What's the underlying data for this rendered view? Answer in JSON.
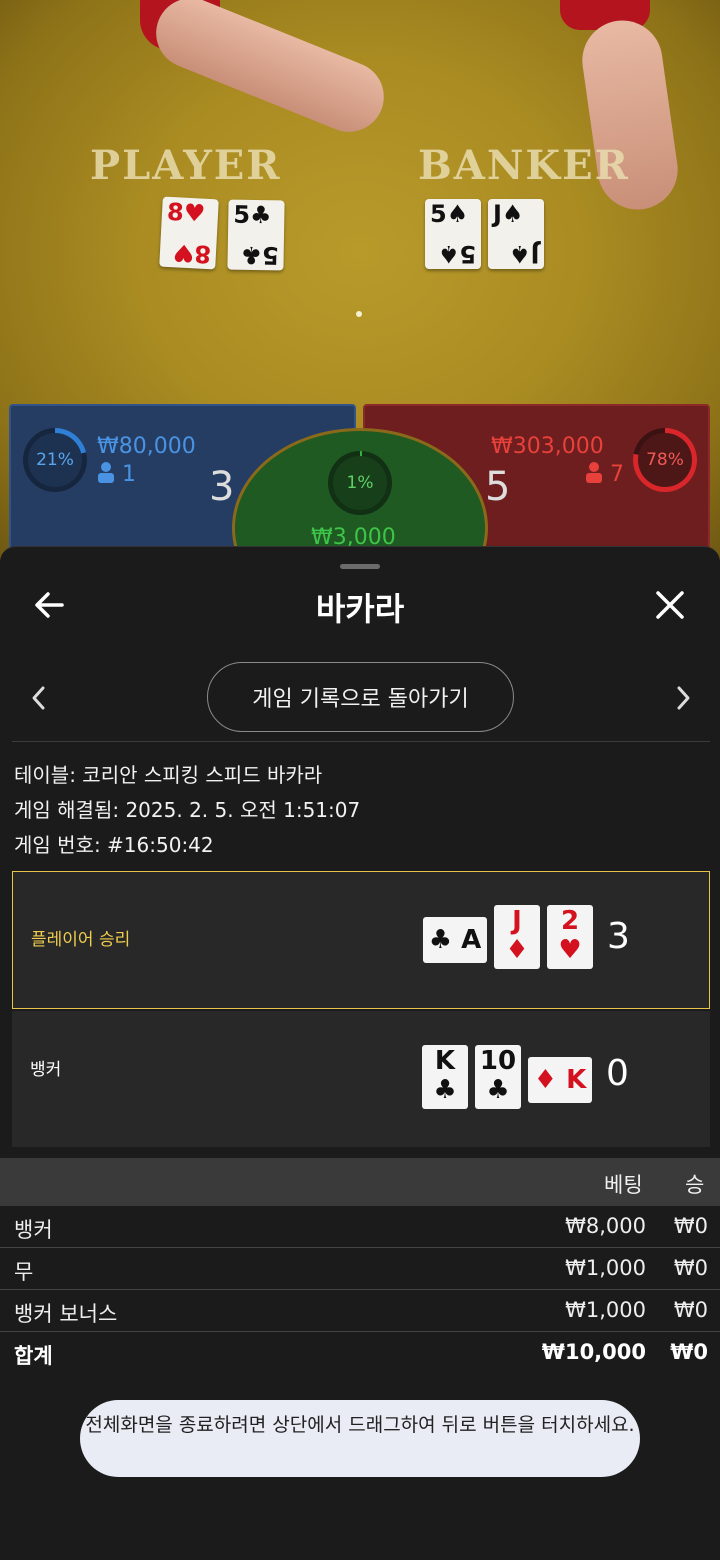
{
  "video": {
    "table_player": "PLAYER",
    "table_banker": "BANKER",
    "player_cards": [
      {
        "rank": "8",
        "suit": "♥",
        "red": true
      },
      {
        "rank": "5",
        "suit": "♣",
        "red": false
      }
    ],
    "banker_cards": [
      {
        "rank": "5",
        "suit": "♠",
        "red": false
      },
      {
        "rank": "J",
        "suit": "♠",
        "red": false
      }
    ],
    "player_panel": {
      "percent": "21%",
      "percent_value": 0.21,
      "amount": "₩80,000",
      "players": "1",
      "score": "3"
    },
    "banker_panel": {
      "percent": "78%",
      "percent_value": 0.78,
      "amount": "₩303,000",
      "players": "7",
      "score": "5"
    },
    "tie_panel": {
      "percent": "1%",
      "percent_value": 0.01,
      "amount": "₩3,000"
    }
  },
  "sheet": {
    "title": "바카라",
    "history_button": "게임 기록으로 돌아가기",
    "table_info": "테이블: 코리안 스피킹 스피드 바카라",
    "resolved_info": "게임 해결됨: 2025. 2. 5. 오전 1:51:07",
    "game_number": "게임 번호: #16:50:42",
    "results": {
      "player": {
        "label": "플레이어 승리",
        "score": "3",
        "cards": [
          {
            "rank": "A",
            "suit": "♣",
            "red": false,
            "side": true
          },
          {
            "rank": "J",
            "suit": "♦",
            "red": true,
            "side": false
          },
          {
            "rank": "2",
            "suit": "♥",
            "red": true,
            "side": false
          }
        ]
      },
      "banker": {
        "label": "뱅커",
        "score": "0",
        "cards": [
          {
            "rank": "K",
            "suit": "♣",
            "red": false,
            "side": false
          },
          {
            "rank": "10",
            "suit": "♣",
            "red": false,
            "side": false
          },
          {
            "rank": "K",
            "suit": "♦",
            "red": true,
            "side": true
          }
        ]
      }
    },
    "bets": {
      "headers": {
        "bet": "베팅",
        "win": "승"
      },
      "rows": [
        {
          "name": "뱅커",
          "bet": "₩8,000",
          "win": "₩0"
        },
        {
          "name": "무",
          "bet": "₩1,000",
          "win": "₩0"
        },
        {
          "name": "뱅커 보너스",
          "bet": "₩1,000",
          "win": "₩0"
        }
      ],
      "total": {
        "name": "합계",
        "bet": "₩10,000",
        "win": "₩0"
      }
    },
    "toast": "전체화면을 종료하려면 상단에서 드래그하여 뒤로 버튼을 터치하세요."
  },
  "colors": {
    "player_blue": "#2f7fd6",
    "banker_red": "#d8262a",
    "tie_green": "#35b040",
    "accent_gold": "#e6c44a"
  }
}
